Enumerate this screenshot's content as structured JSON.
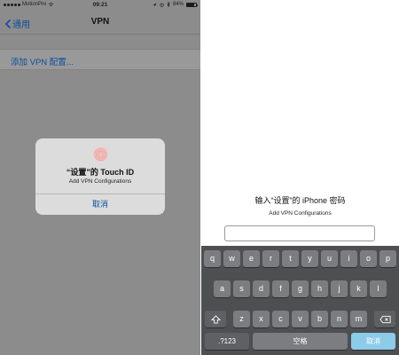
{
  "left_screen": {
    "status_bar": {
      "carrier": "MotionPro",
      "time": "09:21",
      "battery_percent": "84%",
      "battery_level": 0.84,
      "wifi_icon": "wifi-icon",
      "location_icon": "location-icon",
      "alarm_icon": "alarm-icon",
      "bluetooth_icon": "bluetooth-icon"
    },
    "nav": {
      "back_label": "通用",
      "title": "VPN"
    },
    "list": {
      "add_vpn_label": "添加 VPN 配置..."
    },
    "touch_id_alert": {
      "icon": "fingerprint-icon",
      "title": "“设置”的 Touch ID",
      "subtitle": "Add VPN Configurations",
      "cancel_label": "取消"
    }
  },
  "right_screen": {
    "password_prompt": {
      "title": "输入“设置”的 iPhone 密码",
      "subtitle": "Add VPN Configurations",
      "field_value": ""
    },
    "keyboard": {
      "row1": [
        "q",
        "w",
        "e",
        "r",
        "t",
        "y",
        "u",
        "i",
        "o",
        "p"
      ],
      "row2": [
        "a",
        "s",
        "d",
        "f",
        "g",
        "h",
        "j",
        "k",
        "l"
      ],
      "row3": [
        "z",
        "x",
        "c",
        "v",
        "b",
        "n",
        "m"
      ],
      "shift_icon": "shift-icon",
      "delete_icon": "backspace-icon",
      "numbers_label": ".?123",
      "space_label": "空格",
      "done_label": "取消",
      "colors": {
        "background": "#4e4f51",
        "key": "#7c7d80",
        "action_key": "#8ccbea"
      }
    }
  }
}
